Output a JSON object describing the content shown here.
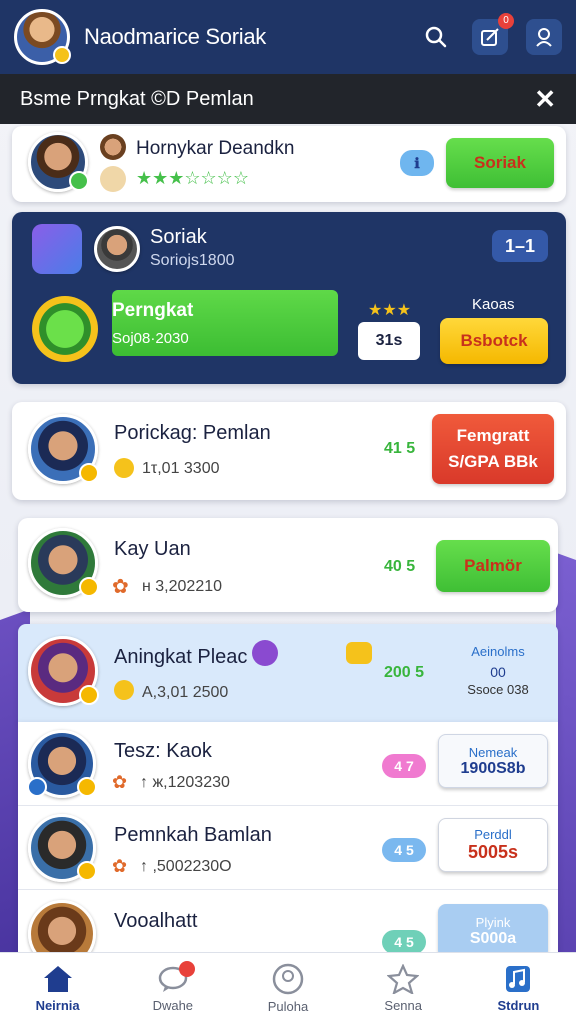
{
  "header": {
    "title": "Naodmarice Soriak",
    "notification_count": "0"
  },
  "subheader": {
    "title": "Bsme Prngkat ©D  Pemlan",
    "close": "✕"
  },
  "cards": {
    "top": {
      "name": "Hornykar Deandkn",
      "stars": "★★★☆☆☆☆",
      "pill": "ℹ",
      "action": "Soriak"
    },
    "featured": {
      "name": "Soriak",
      "sub": "Soriojs1800",
      "counter": "1–1",
      "bar_label": "Perngkat",
      "bar_sub": "Soj08·2030",
      "bar_fill": 1.0,
      "stars": "★★★",
      "box_value": "31s",
      "label_right": "Kaoas",
      "action": "Bsbotck"
    },
    "row1": {
      "name": "Porickag: Pemlan",
      "score": "1τ,01 3300",
      "delta": "41 5",
      "action_line1": "Femgratt",
      "action_line2": "S/GPA BBk"
    },
    "row2": {
      "name": "Kay Uan",
      "score": "н 3,202210",
      "delta": "40 5",
      "action": "Palmör"
    },
    "row3": {
      "name": "Aningkat Pleac",
      "score": "А,3,01 2500",
      "delta": "200 5",
      "stat_line1": "Aeinolms",
      "stat_line2": "00",
      "stat_line3": "Ssoce 038"
    },
    "row4": {
      "name": "Tesz: Kaok",
      "score": "↑ ж,1203230",
      "pill": "4 7",
      "stat_line1": "Nemeak",
      "stat_line2": "1900S8b"
    },
    "row5": {
      "name": "Pemnkah Bamlan",
      "score": "↑ ,5002230O",
      "pill": "4 5",
      "stat_line1": "Perddl",
      "stat_line2": "5005s"
    },
    "row6": {
      "name": "Vooalhatt",
      "pill": "4 5",
      "stat_line1": "Plyink",
      "stat_line2": "S000a"
    }
  },
  "nav": {
    "items": [
      "Neirnia",
      "Dwahe",
      "Puloha",
      "Senna",
      "Stdrun"
    ]
  },
  "colors": {
    "header_bg": "#1f3566",
    "featured_bg": "#1f3566",
    "accent_green": "#45c04a",
    "accent_red": "#e8413a",
    "accent_yellow": "#f5b800"
  }
}
